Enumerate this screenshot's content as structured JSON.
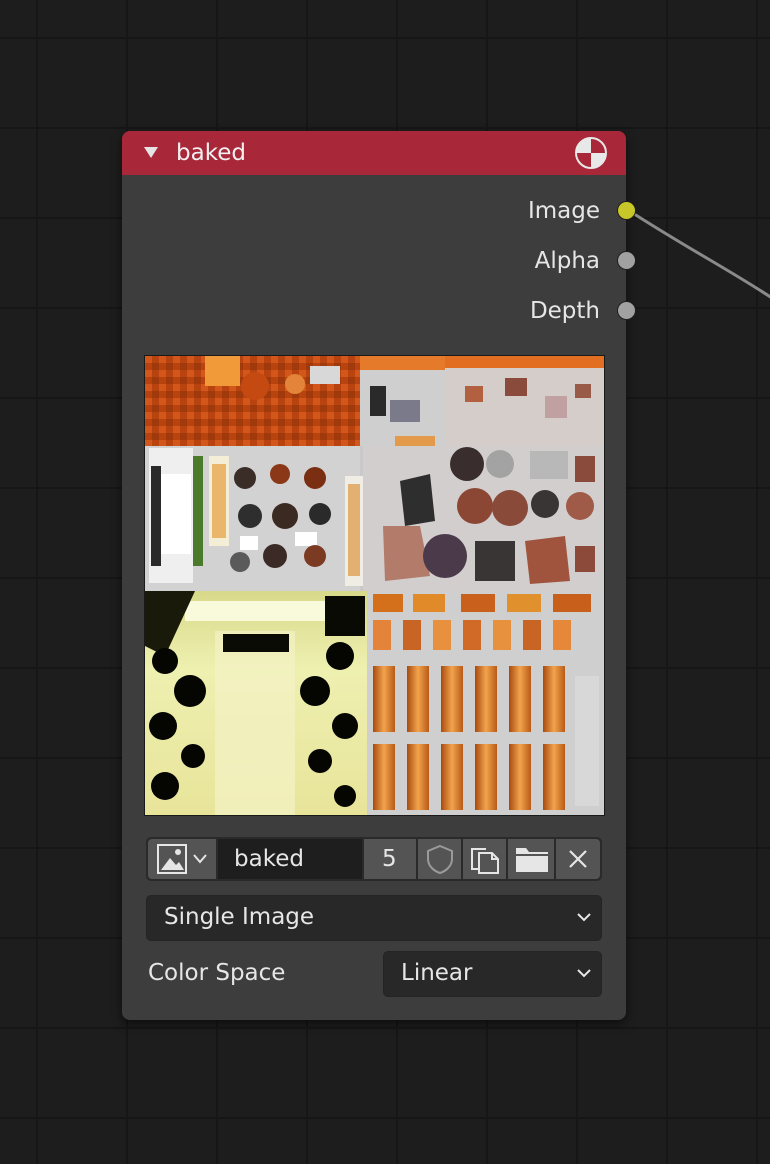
{
  "node": {
    "title": "baked",
    "header_color": "#a8283a",
    "collapse_icon": "triangle-down-icon",
    "type_icon": "image-texture-node-icon"
  },
  "outputs": [
    {
      "label": "Image",
      "socket_color": "#c7c729",
      "linked": true
    },
    {
      "label": "Alpha",
      "socket_color": "#a1a1a1",
      "linked": false
    },
    {
      "label": "Depth",
      "socket_color": "#a1a1a1",
      "linked": false
    }
  ],
  "image_selector": {
    "browse_icon": "image-browse-icon",
    "name": "baked",
    "users": "5",
    "fake_user_icon": "shield-icon",
    "duplicate_icon": "duplicate-icon",
    "open_icon": "folder-icon",
    "unlink_icon": "close-icon"
  },
  "source_dropdown": {
    "value": "Single Image"
  },
  "color_space": {
    "label": "Color Space",
    "value": "Linear"
  }
}
